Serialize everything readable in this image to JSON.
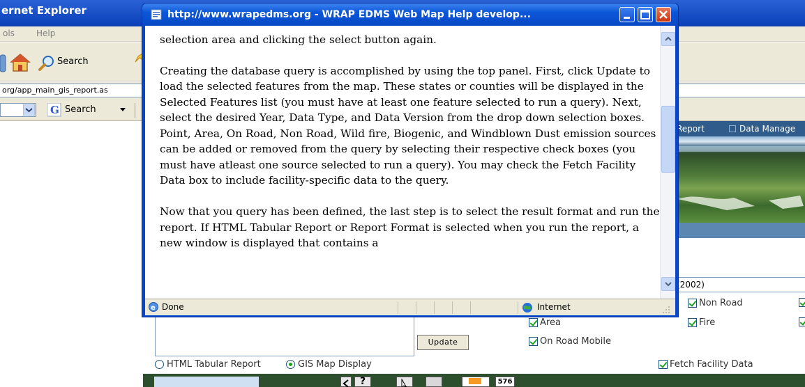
{
  "browser": {
    "title": "ernet Explorer",
    "menu": [
      "ols",
      "Help"
    ],
    "toolbar": {
      "search_label": "Search"
    },
    "address": "org/app_main_gis_report.as",
    "links_search_label": "Search"
  },
  "page": {
    "nav": {
      "report": "Report",
      "data_manage": "Data Manage"
    },
    "year_select": "(2002)",
    "update_button": "Update",
    "sources": {
      "area": "Area",
      "on_road": "On Road Mobile",
      "non_road": "Non Road",
      "fire": "Fire"
    },
    "fetch_facility": "Fetch Facility Data",
    "format_options": {
      "html_tabular": "HTML Tabular Report",
      "gis_map": "GIS Map Display"
    },
    "selected_format": "gis_map",
    "map_scale": "576"
  },
  "popup": {
    "title": "http://www.wrapedms.org - WRAP EDMS Web Map Help develop...",
    "paragraphs": [
      "selection area and clicking the select button again.",
      "Creating the database query is accomplished by using the top panel. First, click Update to load the selected features from the map. These states or counties will be displayed in the Selected Features list (you must have at least one feature selected to run a query). Next, select the desired Year, Data Type, and Data Version from the drop down selection boxes. Point, Area, On Road, Non Road, Wild fire, Biogenic, and Windblown Dust emission sources can be added or removed from the query by selecting their respective check boxes (you must have atleast one source selected to run a query). You may check the Fetch Facility Data box to include facility-specific data to the query.",
      "Now that you query has been defined, the last step is to select the result format and run the report. If HTML Tabular Report or Report Format is selected when you run the report, a new window is displayed that contains a"
    ],
    "status": {
      "left": "Done",
      "zone": "Internet"
    }
  },
  "colors": {
    "xp_blue": "#0a47c8",
    "check_green": "#21a121",
    "page_nav": "#2f5c8a"
  }
}
